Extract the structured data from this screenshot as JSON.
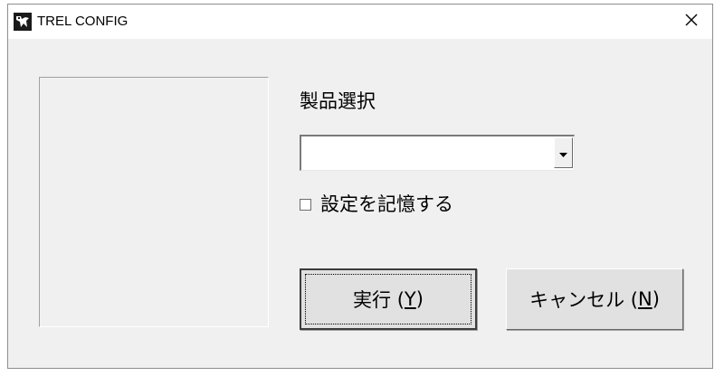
{
  "window": {
    "title": "TREL CONFIG",
    "close_symbol": "✕"
  },
  "icons": {
    "app": "app-logo-icon",
    "close": "close-icon",
    "dropdown": "chevron-down-icon"
  },
  "product": {
    "label": "製品選択",
    "selected_value": ""
  },
  "remember": {
    "label": "設定を記憶する",
    "checked": false
  },
  "buttons": {
    "execute": {
      "prefix": "実行 (",
      "mnemonic": "Y",
      "suffix": ")"
    },
    "cancel": {
      "prefix": "キャンセル (",
      "mnemonic": "N",
      "suffix": ")"
    }
  }
}
